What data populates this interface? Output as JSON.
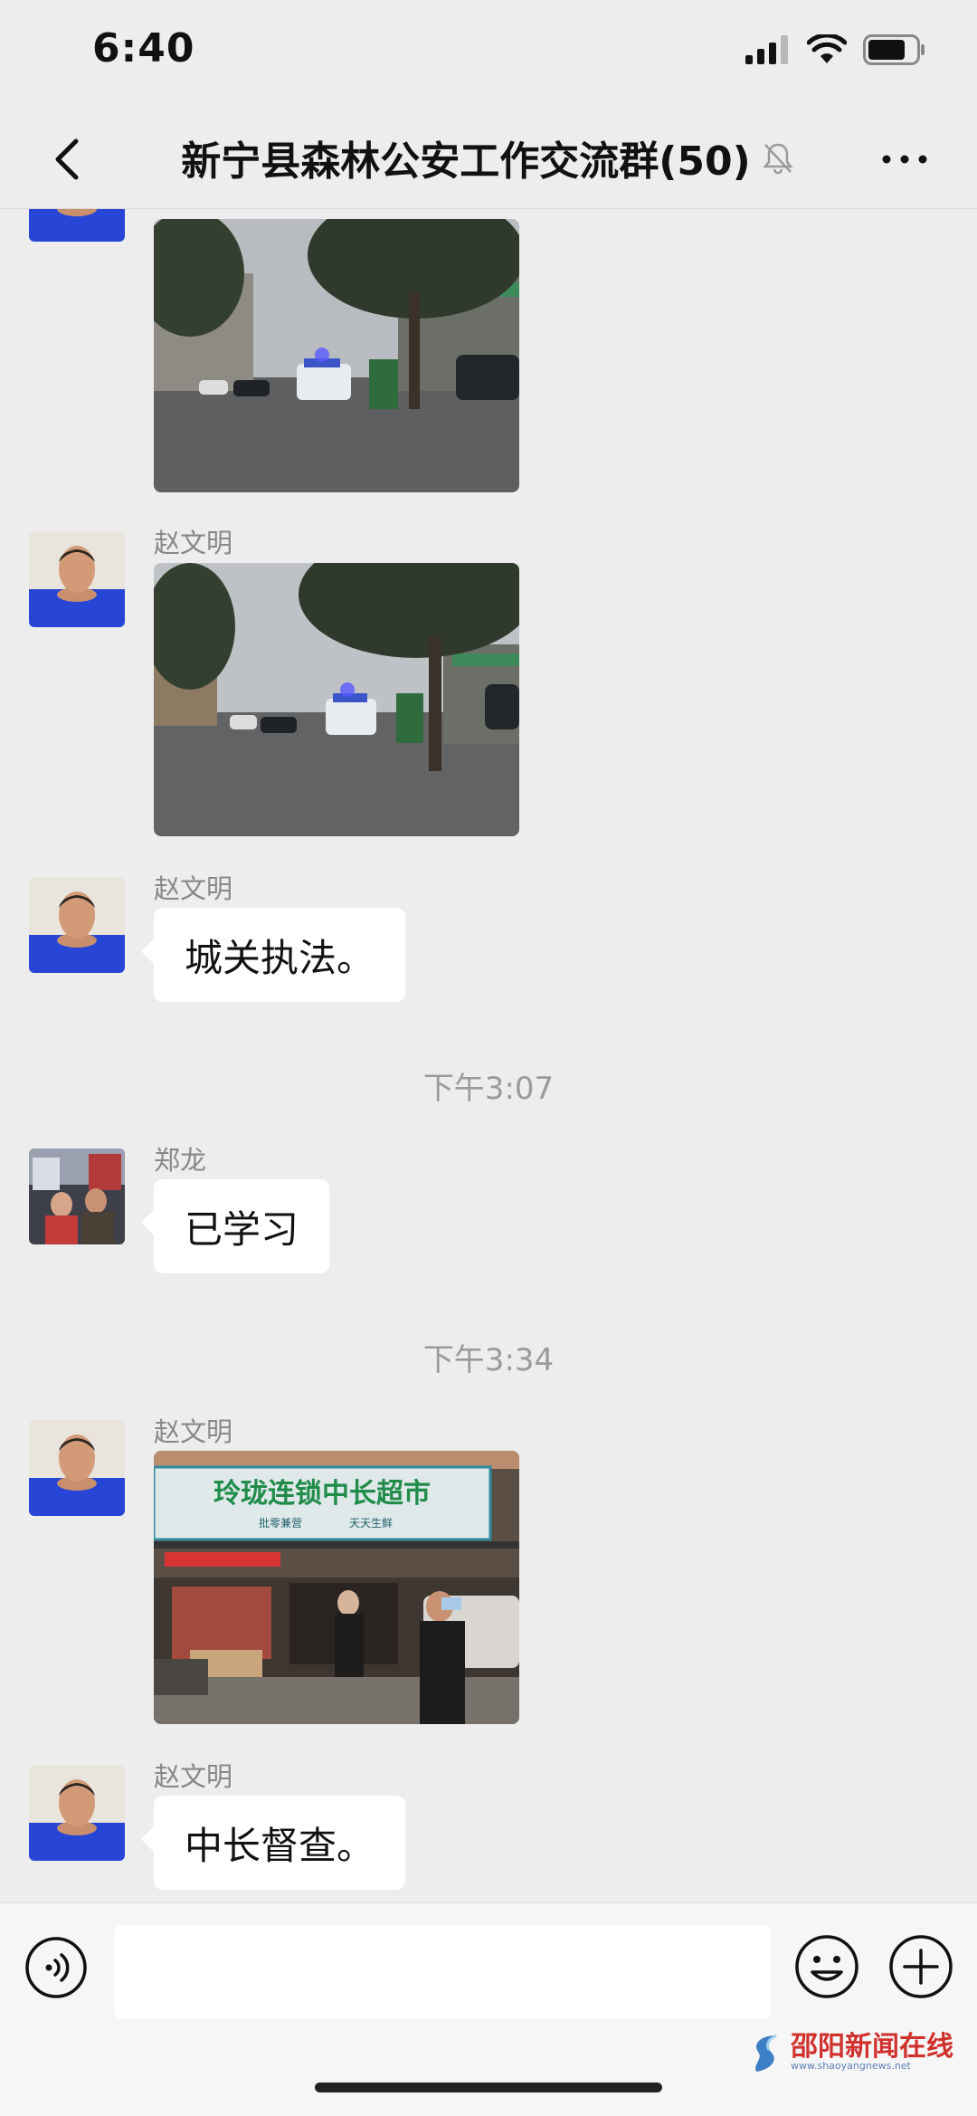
{
  "status_bar": {
    "time": "6:40"
  },
  "nav": {
    "title": "新宁县森林公安工作交流群(50)"
  },
  "messages": [
    {
      "type": "image",
      "sender": "",
      "image_desc": "police car on rainy street"
    },
    {
      "type": "image",
      "sender": "赵文明",
      "image_desc": "police car on rainy street"
    },
    {
      "type": "text",
      "sender": "赵文明",
      "text": "城关执法。"
    },
    {
      "type": "timestamp",
      "text": "下午3:07"
    },
    {
      "type": "text",
      "sender": "郑龙",
      "text": "已学习"
    },
    {
      "type": "timestamp",
      "text": "下午3:34"
    },
    {
      "type": "image",
      "sender": "赵文明",
      "image_desc": "supermarket storefront"
    },
    {
      "type": "text",
      "sender": "赵文明",
      "text": "中长督查。"
    }
  ],
  "photos": {
    "sign_title": "玲珑连锁中长超市",
    "sign_sub1": "批零兼营",
    "sign_sub2": "天天生鲜"
  },
  "input_bar": {
    "placeholder": ""
  },
  "watermark": {
    "name": "邵阳新闻在线",
    "url": "www.shaoyangnews.net"
  },
  "icons": {
    "back": "back-chevron-icon",
    "mute": "mute-bell-icon",
    "more": "more-dots-icon",
    "voice": "voice-icon",
    "emoji": "emoji-icon",
    "plus": "plus-icon"
  },
  "colors": {
    "background": "#ededed",
    "bubble": "#ffffff",
    "muted_text": "#9a9a9a"
  }
}
